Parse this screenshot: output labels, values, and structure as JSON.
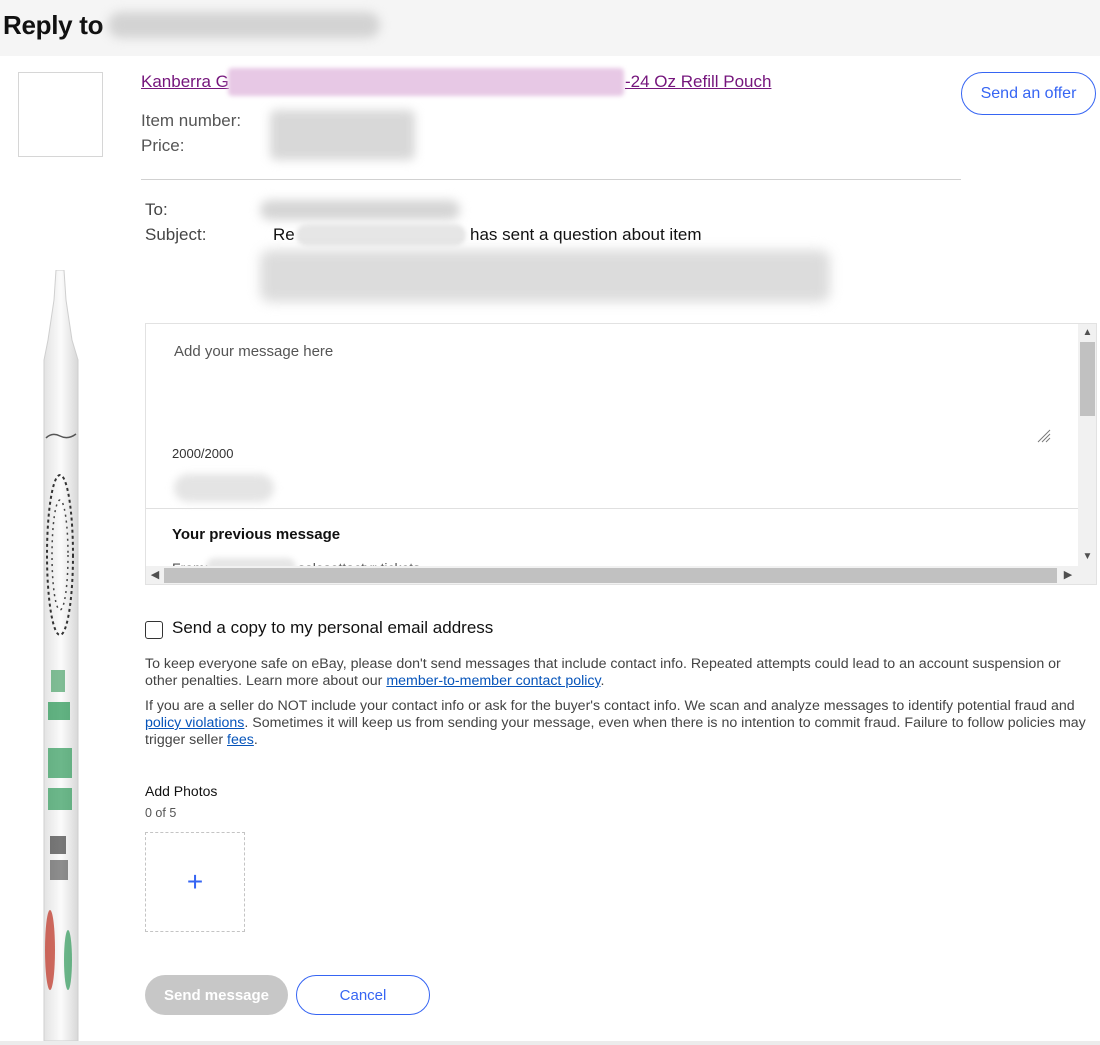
{
  "header": {
    "title": "Reply to"
  },
  "item": {
    "title_start": "Kanberra G",
    "title_end": "-24 Oz Refill Pouch",
    "number_label": "Item number:",
    "price_label": "Price:",
    "offer_button": "Send an offer"
  },
  "compose": {
    "to_label": "To:",
    "subject_label": "Subject:",
    "subject_prefix": "Re",
    "subject_suffix": "has sent a question about item",
    "placeholder": "Add your message here",
    "counter": "2000/2000",
    "previous_title": "Your previous message",
    "previous_from_label": "From:",
    "previous_from_value": "salesottactyr tickets"
  },
  "copy": {
    "label": "Send a copy to my personal email address",
    "checked": false
  },
  "notice": {
    "p1_text": "To keep everyone safe on eBay, please don't send messages that include contact info. Repeated attempts could lead to an account suspension or other penalties. Learn more about our ",
    "p1_link": "member-to-member contact policy",
    "p1_end": ".",
    "p2_text": "If you are a seller do NOT include your contact info or ask for the buyer's contact info. We scan and analyze messages to identify potential fraud and ",
    "p2_link1": "policy violations",
    "p2_mid": ". Sometimes it will keep us from sending your message, even when there is no intention to commit fraud. Failure to follow policies may trigger seller ",
    "p2_link2": "fees",
    "p2_end": "."
  },
  "photos": {
    "label": "Add Photos",
    "count": "0 of 5",
    "add_symbol": "+"
  },
  "actions": {
    "send": "Send message",
    "cancel": "Cancel"
  },
  "colors": {
    "accent": "#3665f3",
    "link": "#0654ba",
    "visited_link": "#75157c",
    "disabled": "#c7c7c7"
  }
}
